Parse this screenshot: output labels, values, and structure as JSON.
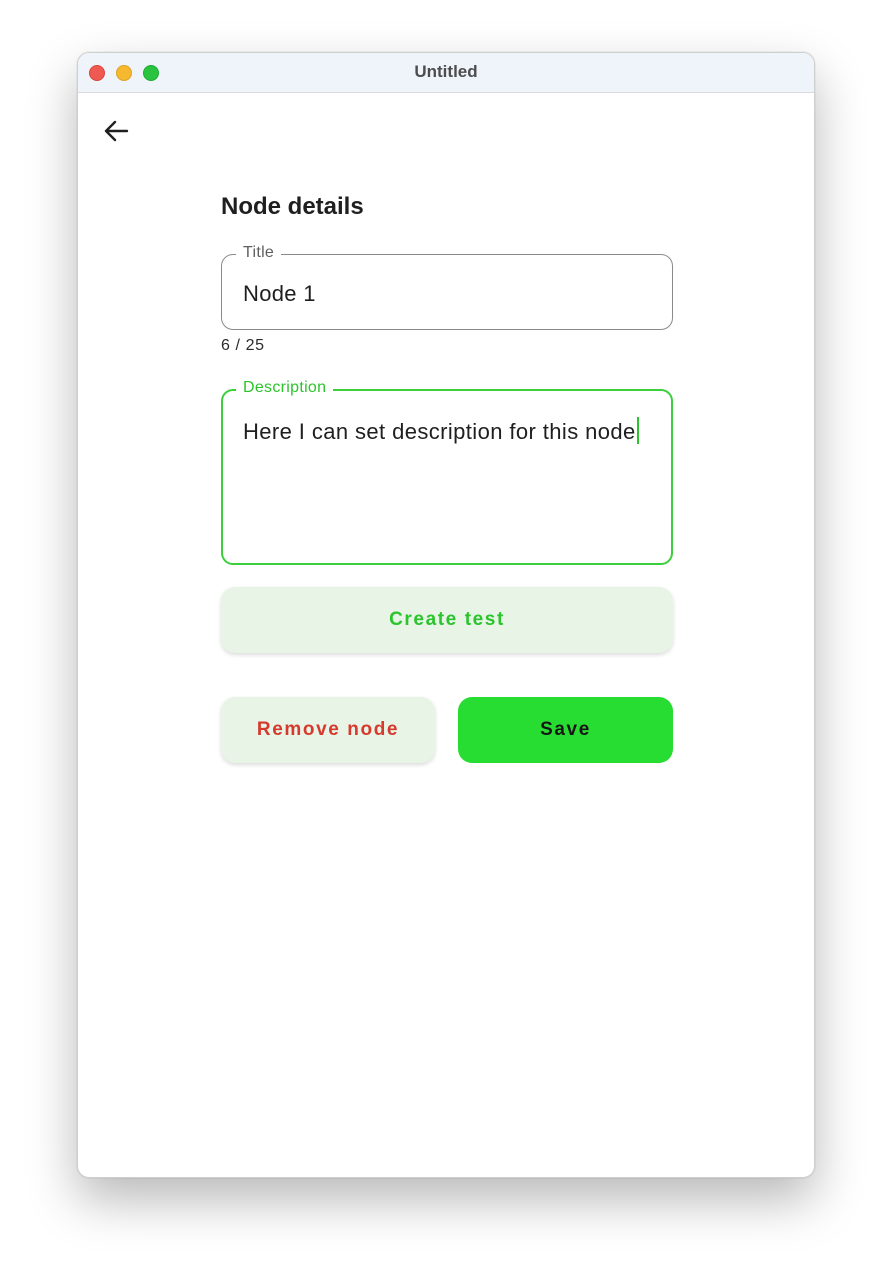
{
  "window": {
    "title": "Untitled",
    "controls": [
      "close",
      "minimize",
      "maximize"
    ]
  },
  "nav": {
    "back_icon": "arrow-left-icon"
  },
  "form": {
    "heading": "Node details",
    "title_field": {
      "label": "Title",
      "value": "Node 1",
      "counter": "6 / 25"
    },
    "description_field": {
      "label": "Description",
      "value": "Here I can set description for this node",
      "focused": true
    }
  },
  "actions": {
    "create_test_label": "Create test",
    "remove_node_label": "Remove node",
    "save_label": "Save"
  },
  "colors": {
    "accent": "#28dd32",
    "accent_text": "#2cc42c",
    "danger": "#d63a2e",
    "button_tint": "#e7f4e6"
  }
}
